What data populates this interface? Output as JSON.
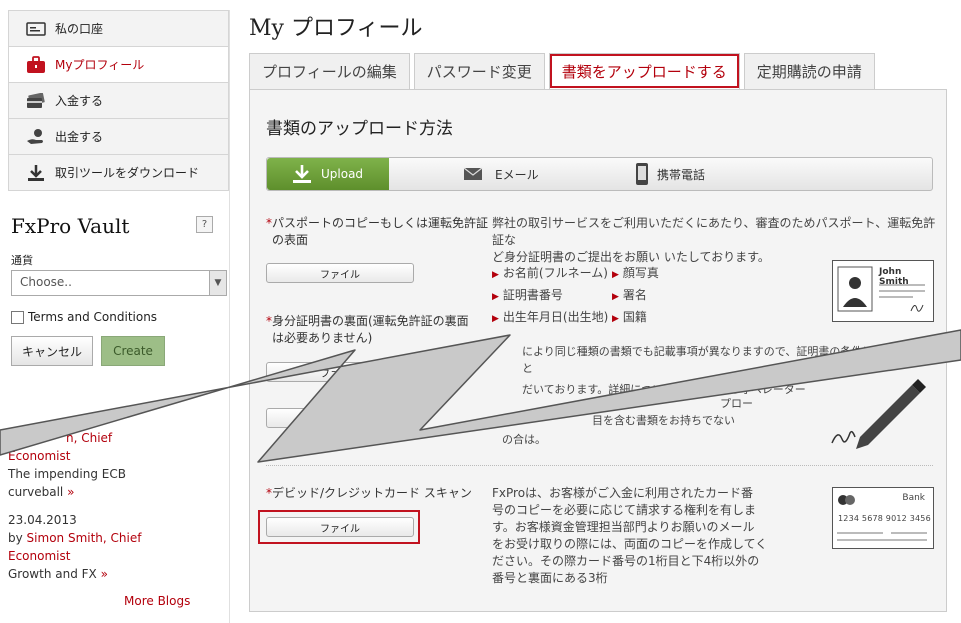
{
  "sidebar": {
    "items": [
      {
        "label": "私の口座",
        "icon": "account-card-icon"
      },
      {
        "label": "Myプロフィール",
        "icon": "briefcase-icon"
      },
      {
        "label": "入金する",
        "icon": "deposit-card-icon"
      },
      {
        "label": "出金する",
        "icon": "withdraw-hand-icon"
      },
      {
        "label": "取引ツールをダウンロード",
        "icon": "download-icon"
      }
    ],
    "vault": {
      "title": "FxPro Vault",
      "help": "?",
      "currency_label": "通貨",
      "currency_placeholder": "Choose..",
      "terms_label": "Terms and Conditions",
      "cancel_label": "キャンセル",
      "create_label": "Create"
    },
    "blogs": [
      {
        "author_suffix": "h, Chief",
        "author_line2": "Economist",
        "title": "The impending ECB",
        "title2": "curveball",
        "more": "»"
      },
      {
        "date": "23.04.2013",
        "by": "by",
        "author": "Simon Smith, Chief",
        "author_line2": "Economist",
        "title": "Growth and FX",
        "more": "»"
      }
    ],
    "more_blogs": "More Blogs"
  },
  "header": {
    "title": "My プロフィール"
  },
  "tabs": [
    {
      "label": "プロフィールの編集"
    },
    {
      "label": "パスワード変更"
    },
    {
      "label": "書類をアップロードする"
    },
    {
      "label": "定期購読の申請"
    }
  ],
  "panel": {
    "title": "書類のアップロード方法",
    "methods": {
      "upload": "Upload",
      "email": "Eメール",
      "phone": "携帯電話"
    },
    "req1_line1": "パスポートのコピーもしくは運転免許証",
    "req1_line2": "の表面",
    "req2_line1": "身分証明書の裏面(運転免許証の裏面",
    "req2_line2": "は必要ありません)",
    "req3": "デビッド/クレジットカード スキャン",
    "file_label": "ファイル",
    "desc1_line1": "弊社の取引サービスをご利用いただくにあたり、審査のためパスポート、運転免許証な",
    "desc1_line2": "ど身分証明書のご提出をお願い いたしております。",
    "bullets_left": [
      "お名前(フルネーム)",
      "証明書番号",
      "出生年月日(出生地)"
    ],
    "bullets_right": [
      "顔写真",
      "署名",
      "国籍"
    ],
    "desc2_line1": "により同じ種類の書類でも記載事項が異なりますので、証明書の条件については国ごと",
    "desc2_line2": "だいております。詳細については対応言語のオペレーター",
    "desc3_line1": "プロー",
    "desc3_line2": "目を含む書類をお持ちでない",
    "desc3_line3": "の合は。",
    "desc4": [
      "FxProは、お客様がご入金に利用されたカード番",
      "号のコピーを必要に応じて請求する権利を有しま",
      "す。お客様資金管理担当部門よりお願いのメール",
      "をお受け取りの際には、両面のコピーを作成してく",
      "ださい。その際カード番号の1桁目と下4桁以外の",
      "番号と裏面にある3桁"
    ],
    "id_name": "John Smith",
    "card_bank": "Bank",
    "card_number": "1234 5678 9012 3456"
  },
  "colors": {
    "accent": "#b3000c",
    "upload_green": "#6aa03a",
    "highlight": "#c1121f"
  }
}
